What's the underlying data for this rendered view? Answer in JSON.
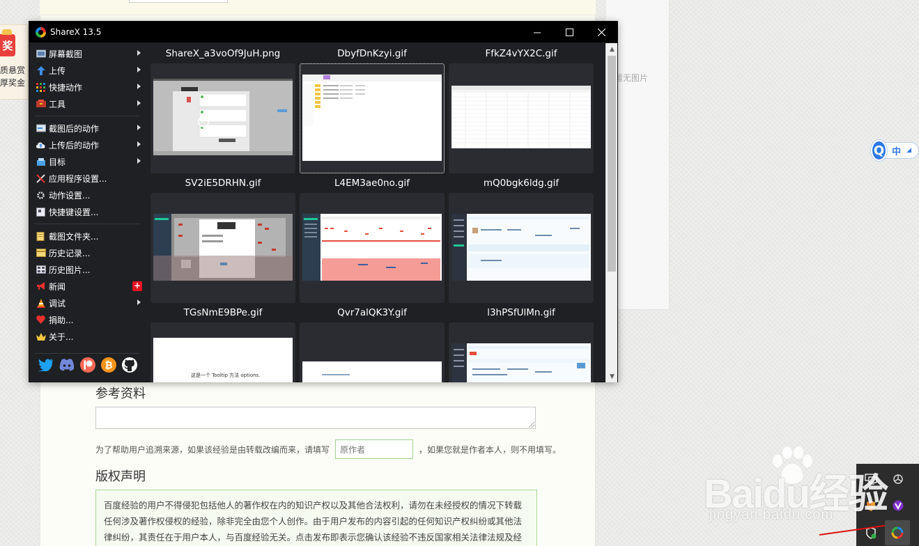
{
  "window": {
    "title": "ShareX 13.5",
    "minimize": "—",
    "maximize": "☐",
    "close": "✕"
  },
  "menu": {
    "items": [
      {
        "label": "屏幕截图",
        "icon": "screenshot-icon",
        "submenu": true
      },
      {
        "label": "上传",
        "icon": "upload-icon",
        "submenu": true
      },
      {
        "label": "快捷动作",
        "icon": "quick-actions-icon",
        "submenu": true
      },
      {
        "label": "工具",
        "icon": "tools-icon",
        "submenu": true
      },
      {
        "label": "截图后的动作",
        "icon": "after-capture-icon",
        "submenu": true
      },
      {
        "label": "上传后的动作",
        "icon": "after-upload-icon",
        "submenu": true
      },
      {
        "label": "目标",
        "icon": "destinations-icon",
        "submenu": true
      },
      {
        "label": "应用程序设置...",
        "icon": "app-settings-icon",
        "submenu": false
      },
      {
        "label": "动作设置...",
        "icon": "task-settings-icon",
        "submenu": false
      },
      {
        "label": "快捷键设置...",
        "icon": "hotkey-settings-icon",
        "submenu": false
      },
      {
        "label": "截图文件夹...",
        "icon": "folder-icon",
        "submenu": false
      },
      {
        "label": "历史记录...",
        "icon": "history-icon",
        "submenu": false
      },
      {
        "label": "历史图片...",
        "icon": "image-history-icon",
        "submenu": false
      },
      {
        "label": "新闻",
        "icon": "news-icon",
        "submenu": false,
        "badge": "+"
      },
      {
        "label": "调试",
        "icon": "debug-icon",
        "submenu": true
      },
      {
        "label": "捐助...",
        "icon": "donate-icon",
        "submenu": false
      },
      {
        "label": "关于...",
        "icon": "about-icon",
        "submenu": false
      }
    ],
    "social": [
      "twitter-icon",
      "discord-icon",
      "patreon-icon",
      "bitcoin-icon",
      "github-icon"
    ]
  },
  "thumbnails": [
    {
      "name": "ShareX_a3voOf9JuH.png",
      "selected": false
    },
    {
      "name": "DbyfDnKzyi.gif",
      "selected": true
    },
    {
      "name": "FfkZ4vYX2C.gif",
      "selected": false
    },
    {
      "name": "SV2iE5DRHN.gif",
      "selected": false
    },
    {
      "name": "L4EM3ae0no.gif",
      "selected": false
    },
    {
      "name": "mQ0bgk6ldg.gif",
      "selected": false
    },
    {
      "name": "TGsNmE9BPe.gif",
      "selected": false,
      "caption": "这是一个 Tooltip 方法 options."
    },
    {
      "name": "Qvr7alQK3Y.gif",
      "selected": false
    },
    {
      "name": "l3hPSfUlMn.gif",
      "selected": false
    }
  ],
  "page": {
    "reward_badge": "奖",
    "reward_line1": "质悬赏",
    "reward_line2": "厚奖金",
    "right_panel_text": "库暂无图片",
    "ime_letter": "Q",
    "ime_lang": "中",
    "ref_title": "参考资料",
    "source_prefix": "为了帮助用户追溯来源，如果该经验是由转载改编而来，请填写",
    "source_placeholder": "原作者",
    "source_suffix": "，如果您就是作者本人，则不用填写。",
    "copyright_title": "版权声明",
    "copyright_text": "百度经验的用户不得侵犯包括他人的著作权在内的知识产权以及其他合法权利，请勿在未经授权的情况下转载任何涉及著作权侵权的经验，除非完全由您个人创作。由于用户发布的内容引起的任何知识产权纠纷或其他法律纠纷，其责任在于用户本人，与百度经验无关。点击发布即表示您确认该经验不违反国家相关法律法规及经验协议，"
  },
  "watermark": {
    "big": "Baidu经验",
    "small": "jingyan.baidu.com"
  },
  "colors": {
    "window_bg": "#1f2023",
    "titlebar": "#000000",
    "thumb_bg": "#2b2c31",
    "accent_blue": "#2f7ae5",
    "news_badge": "#e81123"
  }
}
